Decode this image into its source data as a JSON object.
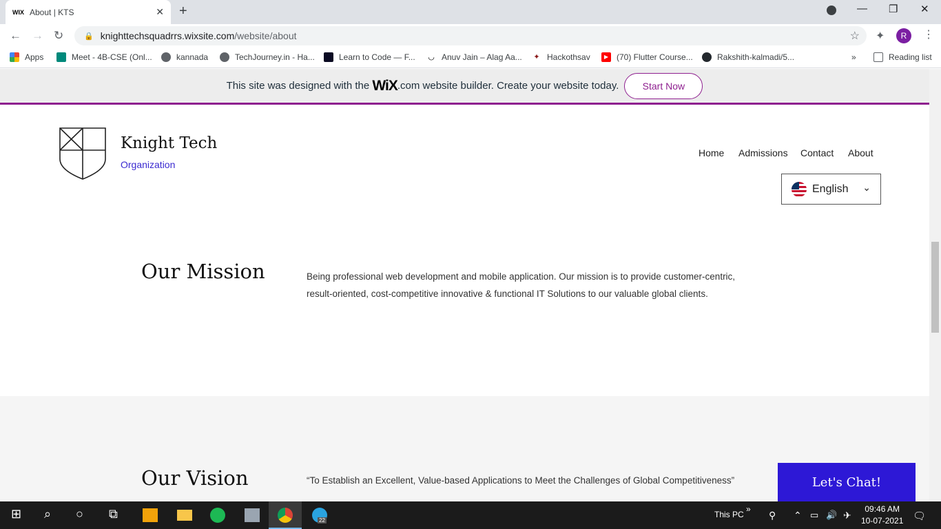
{
  "browser": {
    "tab_title": "About | KTS",
    "tab_favicon": "WIX",
    "url_host": "knighttechsquadrrs.wixsite.com",
    "url_path": "/website/about",
    "avatar_letter": "R",
    "reading_list": "Reading list",
    "bookmarks": [
      "Apps",
      "Meet - 4B-CSE (Onl...",
      "kannada",
      "TechJourney.in - Ha...",
      "Learn to Code — F...",
      "Anuv Jain – Alag Aa...",
      "Hackothsav",
      "(70) Flutter Course...",
      "Rakshith-kalmadi/5..."
    ]
  },
  "wix_banner": {
    "text_before": "This site was designed with the",
    "logo": "WiX",
    "text_after": ".com website builder. Create your website today.",
    "button": "Start Now"
  },
  "site": {
    "brand": "Knight Tech",
    "brand_sub": "Organization",
    "nav": [
      "Home",
      "Admissions",
      "Contact",
      "About"
    ],
    "language": "English"
  },
  "mission": {
    "heading": "Our Mission",
    "line1": "Being professional web development and mobile application. Our mission is to provide customer-centric,",
    "line2": "result-oriented, cost-competitive innovative & functional IT Solutions to our valuable global clients."
  },
  "vision": {
    "heading": "Our Vision",
    "text": "“To Establish an Excellent, Value-based Applications to Meet the Challenges of Global Competitiveness”"
  },
  "chat_button": "Let's Chat!",
  "taskbar": {
    "this_pc": "This PC",
    "time": "09:46 AM",
    "date": "10-07-2021",
    "telegram_badge": "22"
  }
}
